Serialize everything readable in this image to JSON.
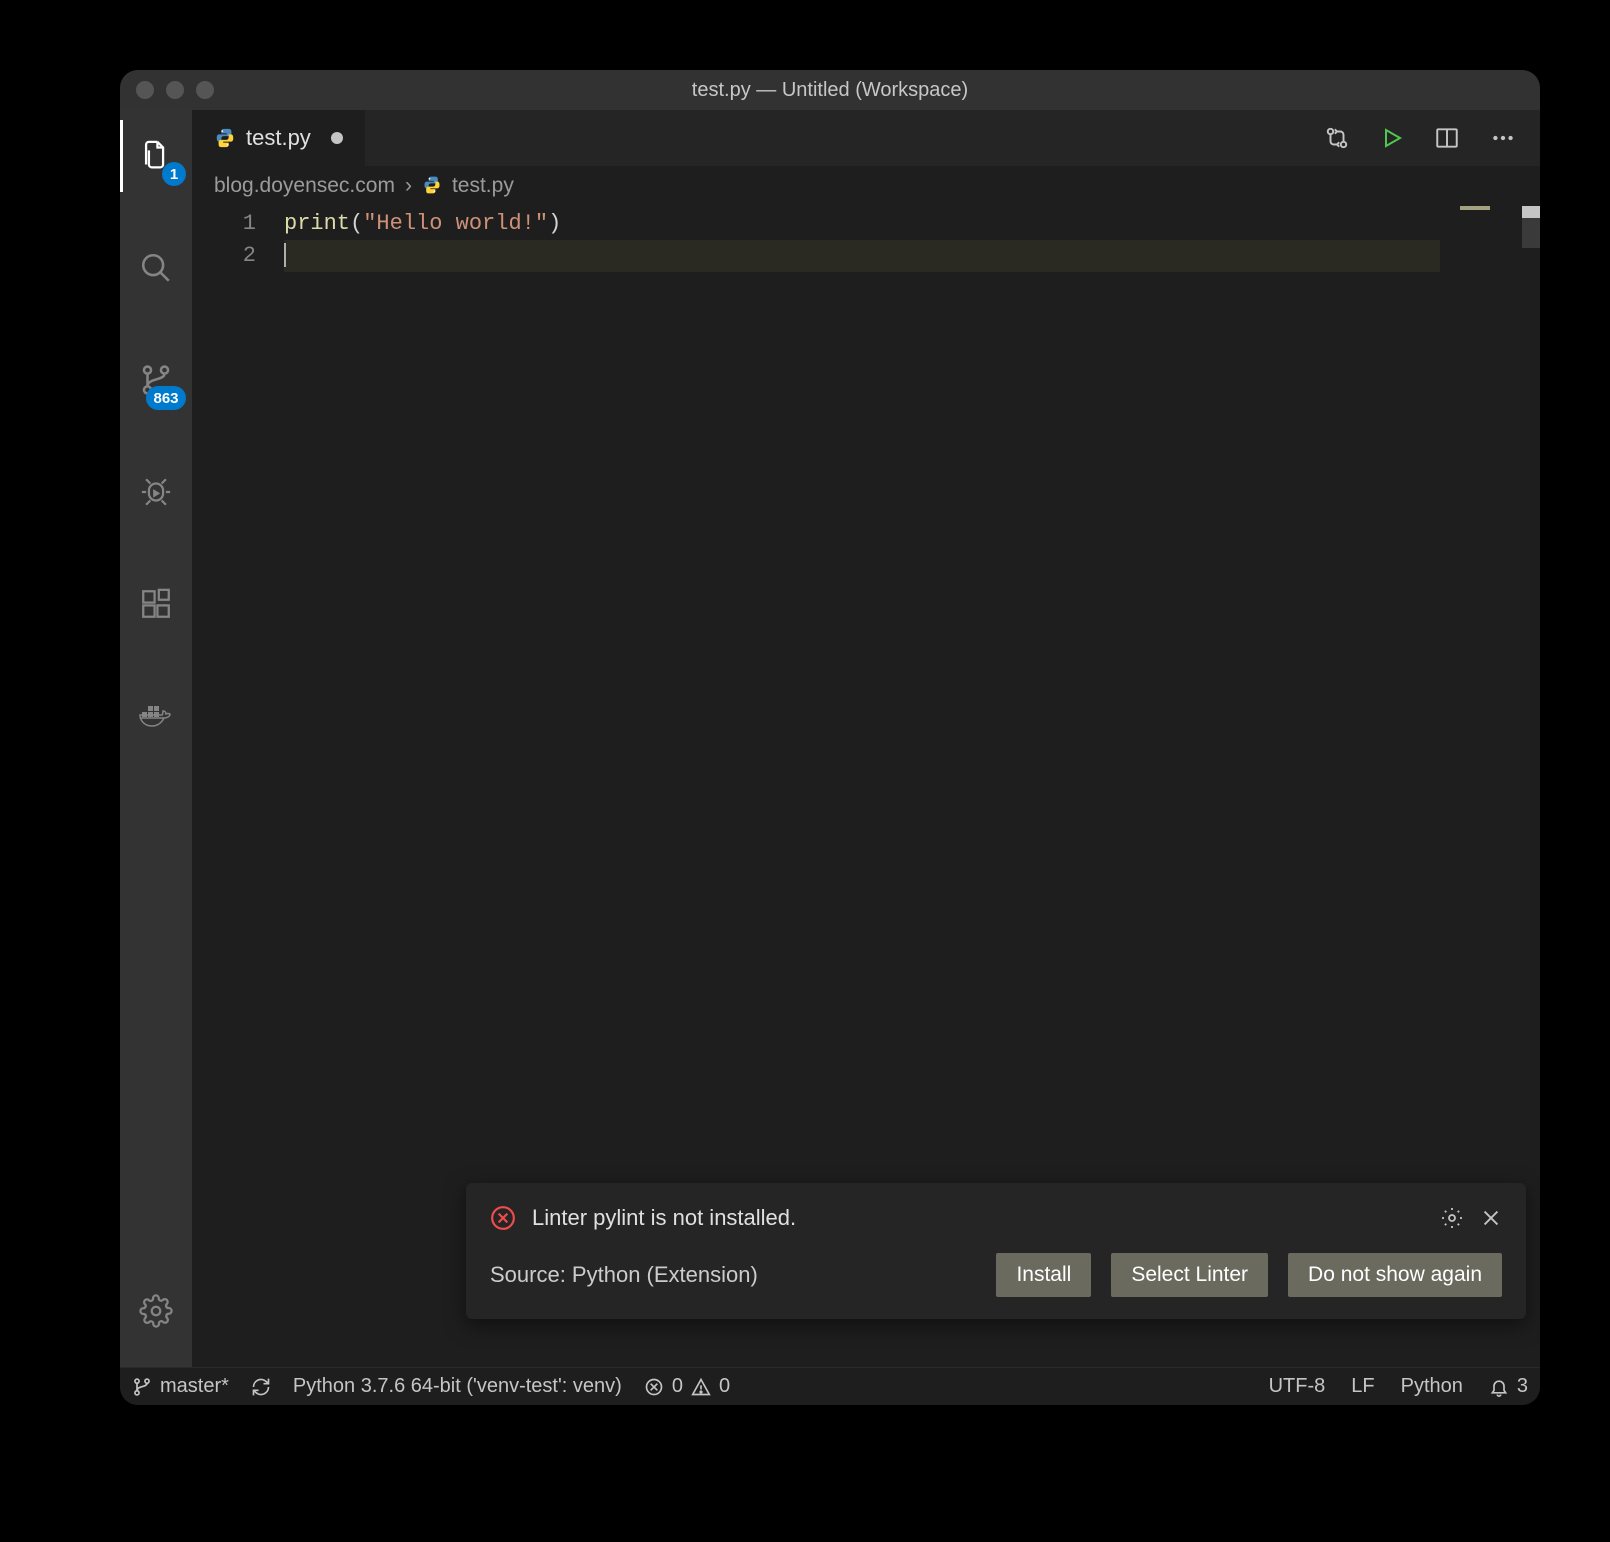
{
  "window": {
    "title": "test.py — Untitled (Workspace)"
  },
  "activitybar": {
    "explorer_badge": "1",
    "scm_badge": "863"
  },
  "tab": {
    "label": "test.py"
  },
  "breadcrumbs": {
    "folder": "blog.doyensec.com",
    "file": "test.py"
  },
  "editor": {
    "line_numbers": [
      "1",
      "2"
    ],
    "line1": {
      "fn": "print",
      "open": "(",
      "str": "\"Hello world!\"",
      "close": ")"
    }
  },
  "notification": {
    "message": "Linter pylint is not installed.",
    "source": "Source: Python (Extension)",
    "buttons": {
      "install": "Install",
      "select": "Select Linter",
      "dismiss": "Do not show again"
    }
  },
  "statusbar": {
    "branch": "master*",
    "interpreter": "Python 3.7.6 64-bit ('venv-test': venv)",
    "errors": "0",
    "warnings": "0",
    "encoding": "UTF-8",
    "eol": "LF",
    "language": "Python",
    "notifications": "3"
  }
}
